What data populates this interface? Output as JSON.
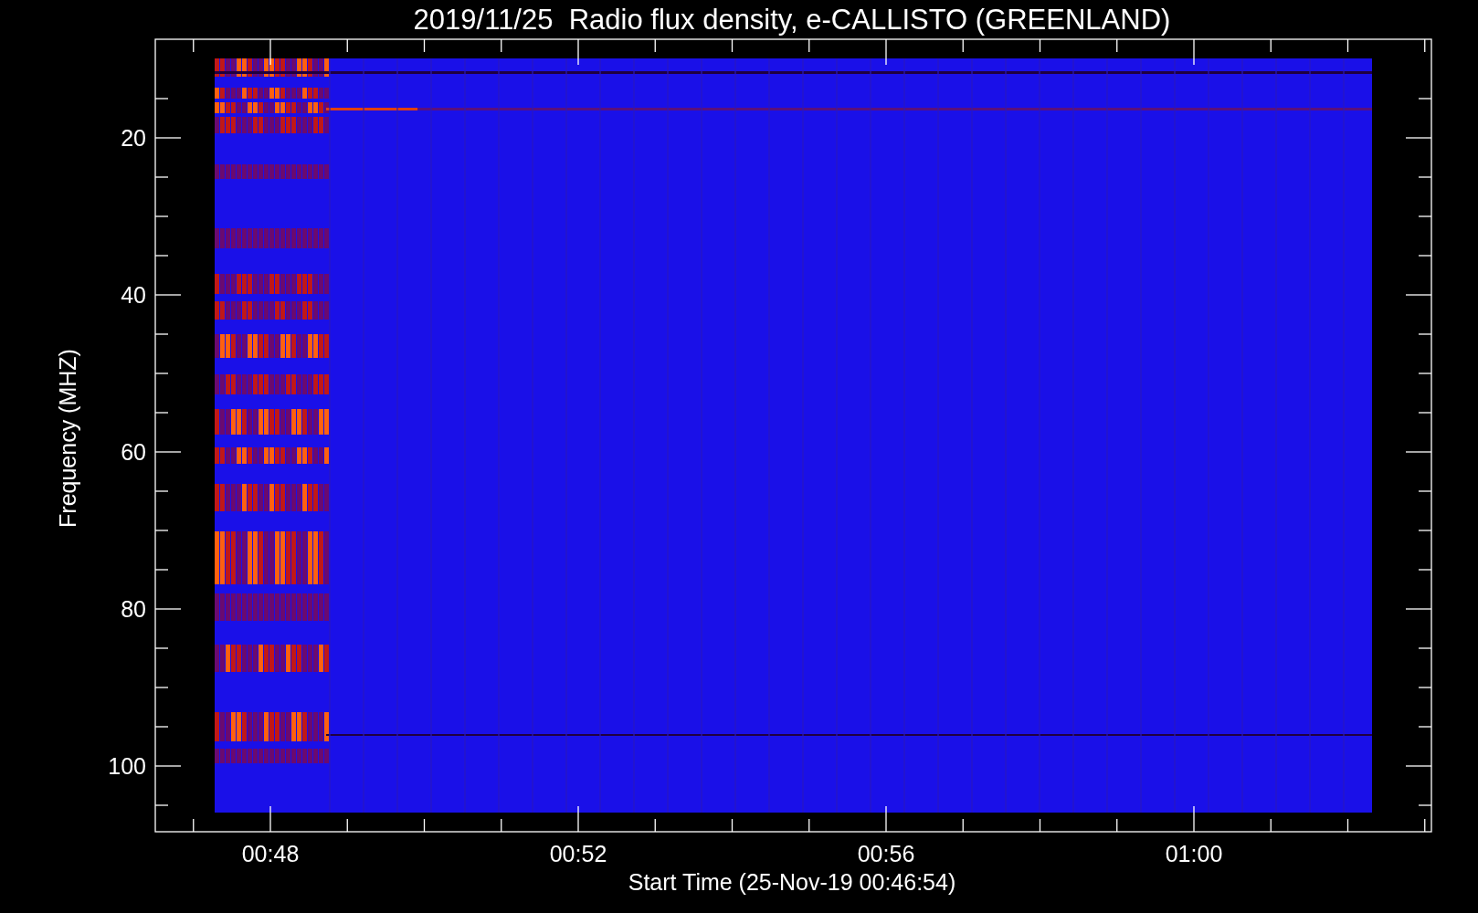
{
  "title": "2019/11/25  Radio flux density, e-CALLISTO (GREENLAND)",
  "y_axis": {
    "label": "Frequency (MHZ)",
    "ticks": [
      "20",
      "40",
      "60",
      "80",
      "100"
    ]
  },
  "x_axis": {
    "label": "Start Time (25-Nov-19 00:46:54)",
    "ticks": [
      "00:48",
      "00:52",
      "00:56",
      "01:00"
    ]
  }
}
